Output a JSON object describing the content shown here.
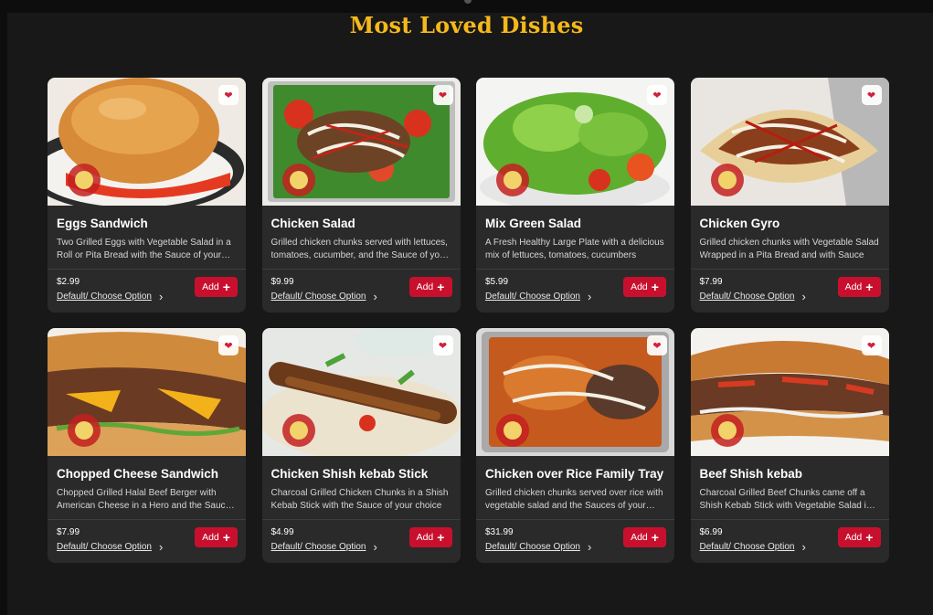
{
  "section": {
    "title": "Most Loved Dishes"
  },
  "actions": {
    "add_label": "Add",
    "option_label": "Default/ Choose Option"
  },
  "icons": {
    "heart": "heart-icon",
    "chevron": "chevron-right-icon",
    "plus": "plus-icon"
  },
  "colors": {
    "accent_gold": "#f5b81b",
    "add_red": "#c8102e",
    "card_bg": "#2a2a2a",
    "page_bg": "#181818"
  },
  "dishes": [
    {
      "name": "Eggs Sandwich",
      "description": "Two Grilled Eggs with Vegetable Salad in a Roll or Pita Bread with the Sauce of your choice",
      "price": "$2.99"
    },
    {
      "name": "Chicken Salad",
      "description": "Grilled chicken chunks served with lettuces, tomatoes, cucumber, and the Sauce of your choice",
      "price": "$9.99"
    },
    {
      "name": "Mix Green Salad",
      "description": "A Fresh Healthy Large Plate with a delicious mix of lettuces, tomatoes, cucumbers",
      "price": "$5.99"
    },
    {
      "name": "Chicken Gyro",
      "description": "Grilled chicken chunks with Vegetable Salad Wrapped in a Pita Bread and with Sauce",
      "price": "$7.99"
    },
    {
      "name": "Chopped Cheese Sandwich",
      "description": "Chopped Grilled Halal Beef Berger with American Cheese in a Hero and the Sauce of your choice",
      "price": "$7.99"
    },
    {
      "name": "Chicken Shish kebab Stick",
      "description": "Charcoal Grilled Chicken Chunks in a Shish Kebab Stick with the Sauce of your choice",
      "price": "$4.99"
    },
    {
      "name": "Chicken over Rice Family Tray",
      "description": "Grilled chicken chunks served over rice with vegetable salad and the Sauces of your choice",
      "price": "$31.99"
    },
    {
      "name": "Beef Shish kebab",
      "description": "Charcoal Grilled Beef Chunks came off a Shish Kebab Stick with Vegetable Salad in a Roll",
      "price": "$6.99"
    }
  ]
}
